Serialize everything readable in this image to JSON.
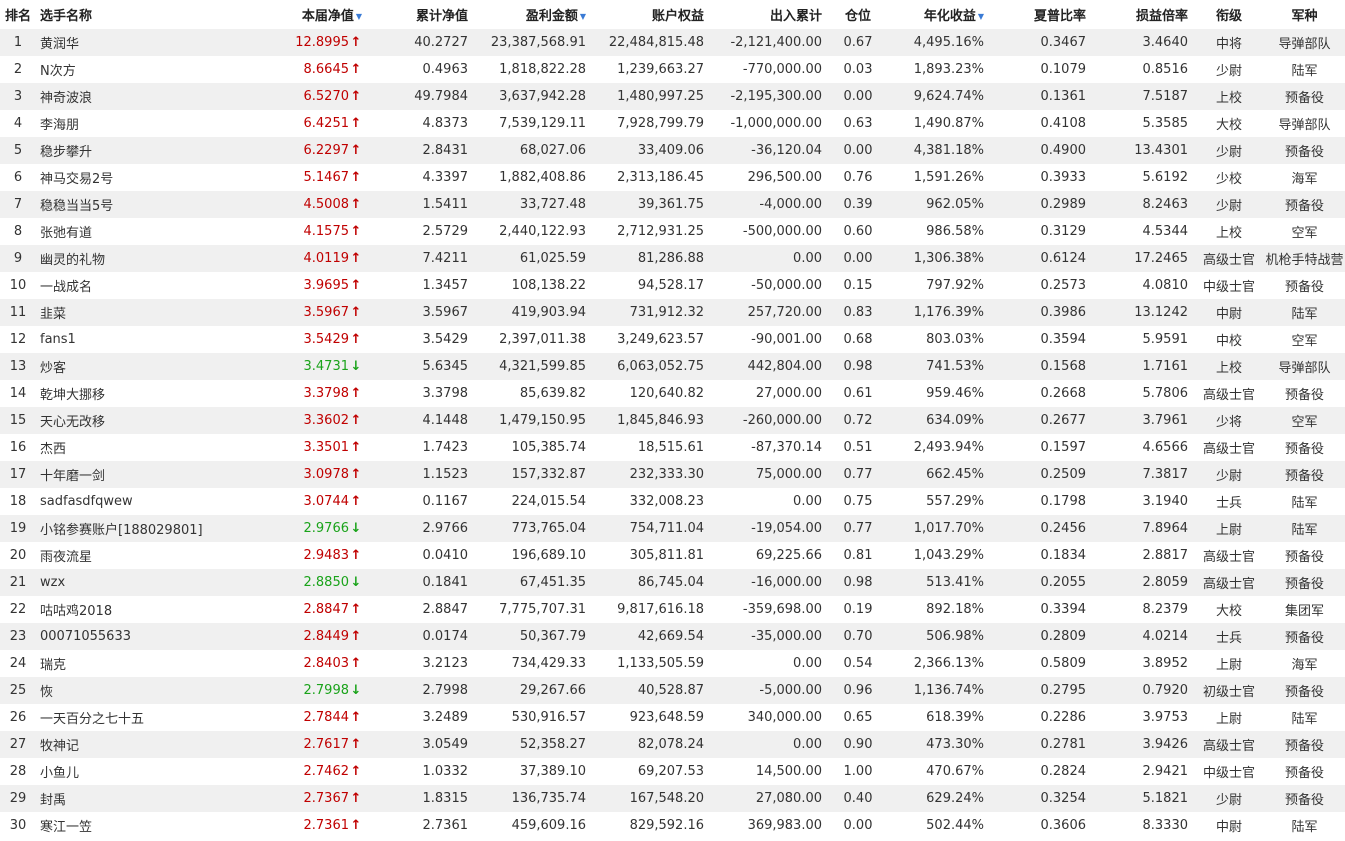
{
  "headers": {
    "rank": "排名",
    "name": "选手名称",
    "nav": "本届净值",
    "cum_nav": "累计净值",
    "profit": "盈利金额",
    "equity": "账户权益",
    "inout": "出入累计",
    "position": "仓位",
    "annual": "年化收益",
    "sharpe": "夏普比率",
    "pl_ratio": "损益倍率",
    "rank_title": "衔级",
    "branch": "军种"
  },
  "sort_icon": "sort-down-triangle-icon",
  "colors": {
    "up": "#c00000",
    "down": "#1aa31a",
    "sort": "#3a7bd5",
    "stripe": "#f0f0f0"
  },
  "rows": [
    {
      "rank": "1",
      "name": "黄润华",
      "nav": "12.8995",
      "dir": "up",
      "cum_nav": "40.2727",
      "profit": "23,387,568.91",
      "equity": "22,484,815.48",
      "inout": "-2,121,400.00",
      "position": "0.67",
      "annual": "4,495.16%",
      "sharpe": "0.3467",
      "pl_ratio": "3.4640",
      "title": "中将",
      "branch": "导弹部队"
    },
    {
      "rank": "2",
      "name": "N次方",
      "nav": "8.6645",
      "dir": "up",
      "cum_nav": "0.4963",
      "profit": "1,818,822.28",
      "equity": "1,239,663.27",
      "inout": "-770,000.00",
      "position": "0.03",
      "annual": "1,893.23%",
      "sharpe": "0.1079",
      "pl_ratio": "0.8516",
      "title": "少尉",
      "branch": "陆军"
    },
    {
      "rank": "3",
      "name": "神奇波浪",
      "nav": "6.5270",
      "dir": "up",
      "cum_nav": "49.7984",
      "profit": "3,637,942.28",
      "equity": "1,480,997.25",
      "inout": "-2,195,300.00",
      "position": "0.00",
      "annual": "9,624.74%",
      "sharpe": "0.1361",
      "pl_ratio": "7.5187",
      "title": "上校",
      "branch": "预备役"
    },
    {
      "rank": "4",
      "name": "李海朋",
      "nav": "6.4251",
      "dir": "up",
      "cum_nav": "4.8373",
      "profit": "7,539,129.11",
      "equity": "7,928,799.79",
      "inout": "-1,000,000.00",
      "position": "0.63",
      "annual": "1,490.87%",
      "sharpe": "0.4108",
      "pl_ratio": "5.3585",
      "title": "大校",
      "branch": "导弹部队"
    },
    {
      "rank": "5",
      "name": "稳步攀升",
      "nav": "6.2297",
      "dir": "up",
      "cum_nav": "2.8431",
      "profit": "68,027.06",
      "equity": "33,409.06",
      "inout": "-36,120.04",
      "position": "0.00",
      "annual": "4,381.18%",
      "sharpe": "0.4900",
      "pl_ratio": "13.4301",
      "title": "少尉",
      "branch": "预备役"
    },
    {
      "rank": "6",
      "name": "神马交易2号",
      "nav": "5.1467",
      "dir": "up",
      "cum_nav": "4.3397",
      "profit": "1,882,408.86",
      "equity": "2,313,186.45",
      "inout": "296,500.00",
      "position": "0.76",
      "annual": "1,591.26%",
      "sharpe": "0.3933",
      "pl_ratio": "5.6192",
      "title": "少校",
      "branch": "海军"
    },
    {
      "rank": "7",
      "name": "稳稳当当5号",
      "nav": "4.5008",
      "dir": "up",
      "cum_nav": "1.5411",
      "profit": "33,727.48",
      "equity": "39,361.75",
      "inout": "-4,000.00",
      "position": "0.39",
      "annual": "962.05%",
      "sharpe": "0.2989",
      "pl_ratio": "8.2463",
      "title": "少尉",
      "branch": "预备役"
    },
    {
      "rank": "8",
      "name": "张弛有道",
      "nav": "4.1575",
      "dir": "up",
      "cum_nav": "2.5729",
      "profit": "2,440,122.93",
      "equity": "2,712,931.25",
      "inout": "-500,000.00",
      "position": "0.60",
      "annual": "986.58%",
      "sharpe": "0.3129",
      "pl_ratio": "4.5344",
      "title": "上校",
      "branch": "空军"
    },
    {
      "rank": "9",
      "name": "幽灵的礼物",
      "nav": "4.0119",
      "dir": "up",
      "cum_nav": "7.4211",
      "profit": "61,025.59",
      "equity": "81,286.88",
      "inout": "0.00",
      "position": "0.00",
      "annual": "1,306.38%",
      "sharpe": "0.6124",
      "pl_ratio": "17.2465",
      "title": "高级士官",
      "branch": "机枪手特战营"
    },
    {
      "rank": "10",
      "name": "一战成名",
      "nav": "3.9695",
      "dir": "up",
      "cum_nav": "1.3457",
      "profit": "108,138.22",
      "equity": "94,528.17",
      "inout": "-50,000.00",
      "position": "0.15",
      "annual": "797.92%",
      "sharpe": "0.2573",
      "pl_ratio": "4.0810",
      "title": "中级士官",
      "branch": "预备役"
    },
    {
      "rank": "11",
      "name": "韭菜",
      "nav": "3.5967",
      "dir": "up",
      "cum_nav": "3.5967",
      "profit": "419,903.94",
      "equity": "731,912.32",
      "inout": "257,720.00",
      "position": "0.83",
      "annual": "1,176.39%",
      "sharpe": "0.3986",
      "pl_ratio": "13.1242",
      "title": "中尉",
      "branch": "陆军"
    },
    {
      "rank": "12",
      "name": "fans1",
      "nav": "3.5429",
      "dir": "up",
      "cum_nav": "3.5429",
      "profit": "2,397,011.38",
      "equity": "3,249,623.57",
      "inout": "-90,001.00",
      "position": "0.68",
      "annual": "803.03%",
      "sharpe": "0.3594",
      "pl_ratio": "5.9591",
      "title": "中校",
      "branch": "空军"
    },
    {
      "rank": "13",
      "name": "炒客",
      "nav": "3.4731",
      "dir": "down",
      "cum_nav": "5.6345",
      "profit": "4,321,599.85",
      "equity": "6,063,052.75",
      "inout": "442,804.00",
      "position": "0.98",
      "annual": "741.53%",
      "sharpe": "0.1568",
      "pl_ratio": "1.7161",
      "title": "上校",
      "branch": "导弹部队"
    },
    {
      "rank": "14",
      "name": "乾坤大挪移",
      "nav": "3.3798",
      "dir": "up",
      "cum_nav": "3.3798",
      "profit": "85,639.82",
      "equity": "120,640.82",
      "inout": "27,000.00",
      "position": "0.61",
      "annual": "959.46%",
      "sharpe": "0.2668",
      "pl_ratio": "5.7806",
      "title": "高级士官",
      "branch": "预备役"
    },
    {
      "rank": "15",
      "name": "天心无改移",
      "nav": "3.3602",
      "dir": "up",
      "cum_nav": "4.1448",
      "profit": "1,479,150.95",
      "equity": "1,845,846.93",
      "inout": "-260,000.00",
      "position": "0.72",
      "annual": "634.09%",
      "sharpe": "0.2677",
      "pl_ratio": "3.7961",
      "title": "少将",
      "branch": "空军"
    },
    {
      "rank": "16",
      "name": "杰西",
      "nav": "3.3501",
      "dir": "up",
      "cum_nav": "1.7423",
      "profit": "105,385.74",
      "equity": "18,515.61",
      "inout": "-87,370.14",
      "position": "0.51",
      "annual": "2,493.94%",
      "sharpe": "0.1597",
      "pl_ratio": "4.6566",
      "title": "高级士官",
      "branch": "预备役"
    },
    {
      "rank": "17",
      "name": "十年磨一剑",
      "nav": "3.0978",
      "dir": "up",
      "cum_nav": "1.1523",
      "profit": "157,332.87",
      "equity": "232,333.30",
      "inout": "75,000.00",
      "position": "0.77",
      "annual": "662.45%",
      "sharpe": "0.2509",
      "pl_ratio": "7.3817",
      "title": "少尉",
      "branch": "预备役"
    },
    {
      "rank": "18",
      "name": "sadfasdfqwew",
      "nav": "3.0744",
      "dir": "up",
      "cum_nav": "0.1167",
      "profit": "224,015.54",
      "equity": "332,008.23",
      "inout": "0.00",
      "position": "0.75",
      "annual": "557.29%",
      "sharpe": "0.1798",
      "pl_ratio": "3.1940",
      "title": "士兵",
      "branch": "陆军"
    },
    {
      "rank": "19",
      "name": "小铭参赛账户[188029801]",
      "nav": "2.9766",
      "dir": "down",
      "cum_nav": "2.9766",
      "profit": "773,765.04",
      "equity": "754,711.04",
      "inout": "-19,054.00",
      "position": "0.77",
      "annual": "1,017.70%",
      "sharpe": "0.2456",
      "pl_ratio": "7.8964",
      "title": "上尉",
      "branch": "陆军"
    },
    {
      "rank": "20",
      "name": "雨夜流星",
      "nav": "2.9483",
      "dir": "up",
      "cum_nav": "0.0410",
      "profit": "196,689.10",
      "equity": "305,811.81",
      "inout": "69,225.66",
      "position": "0.81",
      "annual": "1,043.29%",
      "sharpe": "0.1834",
      "pl_ratio": "2.8817",
      "title": "高级士官",
      "branch": "预备役"
    },
    {
      "rank": "21",
      "name": "wzx",
      "nav": "2.8850",
      "dir": "down",
      "cum_nav": "0.1841",
      "profit": "67,451.35",
      "equity": "86,745.04",
      "inout": "-16,000.00",
      "position": "0.98",
      "annual": "513.41%",
      "sharpe": "0.2055",
      "pl_ratio": "2.8059",
      "title": "高级士官",
      "branch": "预备役"
    },
    {
      "rank": "22",
      "name": "咕咕鸡2018",
      "nav": "2.8847",
      "dir": "up",
      "cum_nav": "2.8847",
      "profit": "7,775,707.31",
      "equity": "9,817,616.18",
      "inout": "-359,698.00",
      "position": "0.19",
      "annual": "892.18%",
      "sharpe": "0.3394",
      "pl_ratio": "8.2379",
      "title": "大校",
      "branch": "集团军"
    },
    {
      "rank": "23",
      "name": "00071055633",
      "nav": "2.8449",
      "dir": "up",
      "cum_nav": "0.0174",
      "profit": "50,367.79",
      "equity": "42,669.54",
      "inout": "-35,000.00",
      "position": "0.70",
      "annual": "506.98%",
      "sharpe": "0.2809",
      "pl_ratio": "4.0214",
      "title": "士兵",
      "branch": "预备役"
    },
    {
      "rank": "24",
      "name": "瑞克",
      "nav": "2.8403",
      "dir": "up",
      "cum_nav": "3.2123",
      "profit": "734,429.33",
      "equity": "1,133,505.59",
      "inout": "0.00",
      "position": "0.54",
      "annual": "2,366.13%",
      "sharpe": "0.5809",
      "pl_ratio": "3.8952",
      "title": "上尉",
      "branch": "海军"
    },
    {
      "rank": "25",
      "name": "恢",
      "nav": "2.7998",
      "dir": "down",
      "cum_nav": "2.7998",
      "profit": "29,267.66",
      "equity": "40,528.87",
      "inout": "-5,000.00",
      "position": "0.96",
      "annual": "1,136.74%",
      "sharpe": "0.2795",
      "pl_ratio": "0.7920",
      "title": "初级士官",
      "branch": "预备役"
    },
    {
      "rank": "26",
      "name": "一天百分之七十五",
      "nav": "2.7844",
      "dir": "up",
      "cum_nav": "3.2489",
      "profit": "530,916.57",
      "equity": "923,648.59",
      "inout": "340,000.00",
      "position": "0.65",
      "annual": "618.39%",
      "sharpe": "0.2286",
      "pl_ratio": "3.9753",
      "title": "上尉",
      "branch": "陆军"
    },
    {
      "rank": "27",
      "name": "牧神记",
      "nav": "2.7617",
      "dir": "up",
      "cum_nav": "3.0549",
      "profit": "52,358.27",
      "equity": "82,078.24",
      "inout": "0.00",
      "position": "0.90",
      "annual": "473.30%",
      "sharpe": "0.2781",
      "pl_ratio": "3.9426",
      "title": "高级士官",
      "branch": "预备役"
    },
    {
      "rank": "28",
      "name": "小鱼儿",
      "nav": "2.7462",
      "dir": "up",
      "cum_nav": "1.0332",
      "profit": "37,389.10",
      "equity": "69,207.53",
      "inout": "14,500.00",
      "position": "1.00",
      "annual": "470.67%",
      "sharpe": "0.2824",
      "pl_ratio": "2.9421",
      "title": "中级士官",
      "branch": "预备役"
    },
    {
      "rank": "29",
      "name": "封禹",
      "nav": "2.7367",
      "dir": "up",
      "cum_nav": "1.8315",
      "profit": "136,735.74",
      "equity": "167,548.20",
      "inout": "27,080.00",
      "position": "0.40",
      "annual": "629.24%",
      "sharpe": "0.3254",
      "pl_ratio": "5.1821",
      "title": "少尉",
      "branch": "预备役"
    },
    {
      "rank": "30",
      "name": "寒江一笠",
      "nav": "2.7361",
      "dir": "up",
      "cum_nav": "2.7361",
      "profit": "459,609.16",
      "equity": "829,592.16",
      "inout": "369,983.00",
      "position": "0.00",
      "annual": "502.44%",
      "sharpe": "0.3606",
      "pl_ratio": "8.3330",
      "title": "中尉",
      "branch": "陆军"
    }
  ]
}
